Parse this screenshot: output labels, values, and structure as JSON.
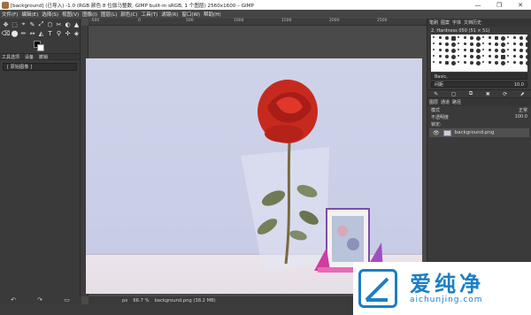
{
  "window": {
    "title": "[background] (已导入) -1.0 (RGB 颜色 8 位伽马整数, GIMP built-in sRGB, 1 个图层) 2560x1600 – GIMP",
    "minimize": "—",
    "maximize": "❐",
    "close": "✕"
  },
  "menubar": [
    "文件(F)",
    "编辑(E)",
    "选择(S)",
    "视图(V)",
    "图像(I)",
    "图层(L)",
    "颜色(C)",
    "工具(T)",
    "滤镜(R)",
    "窗口(W)",
    "帮助(H)"
  ],
  "toolbox": {
    "tools": [
      "✥",
      "⬚",
      "⌖",
      "✎",
      "⤢",
      "⬡",
      "✂",
      "◐",
      "▲",
      "⌫",
      "⬤",
      "✏",
      "↔",
      "◭",
      "T",
      "⚲",
      "✢",
      "◈",
      "☼",
      "⟲",
      "✒",
      "⊕",
      "⊙",
      "⚗",
      "⧉",
      "⬒",
      "≡"
    ],
    "tabs": [
      "工具选项",
      "设备",
      "撤销"
    ],
    "reset_label": "[ 原始图像 ]"
  },
  "ruler": {
    "ticks": [
      "-500",
      "0",
      "500",
      "1000",
      "1500",
      "2000",
      "2500"
    ]
  },
  "status": {
    "unit": "px",
    "zoom": "66.7 %",
    "file": "background.png (38.2 MB)"
  },
  "right_panel": {
    "top_tabs": [
      "笔刷",
      "图案",
      "字体",
      "文档历史"
    ],
    "brush_name": "2. Hardness 050 (51 × 51)",
    "preset_label": "Basic,",
    "spacing_label": "间距",
    "spacing_value": "10.0",
    "layer_tabs": [
      "图层",
      "通道",
      "路径"
    ],
    "mode_label": "模式",
    "mode_value": "正常",
    "opacity_label": "不透明度",
    "opacity_value": "100.0",
    "lock_label": "锁定:",
    "layer_name": "background.png"
  },
  "watermark": {
    "cn": "爱纯净",
    "url": "aichunjing.com"
  }
}
